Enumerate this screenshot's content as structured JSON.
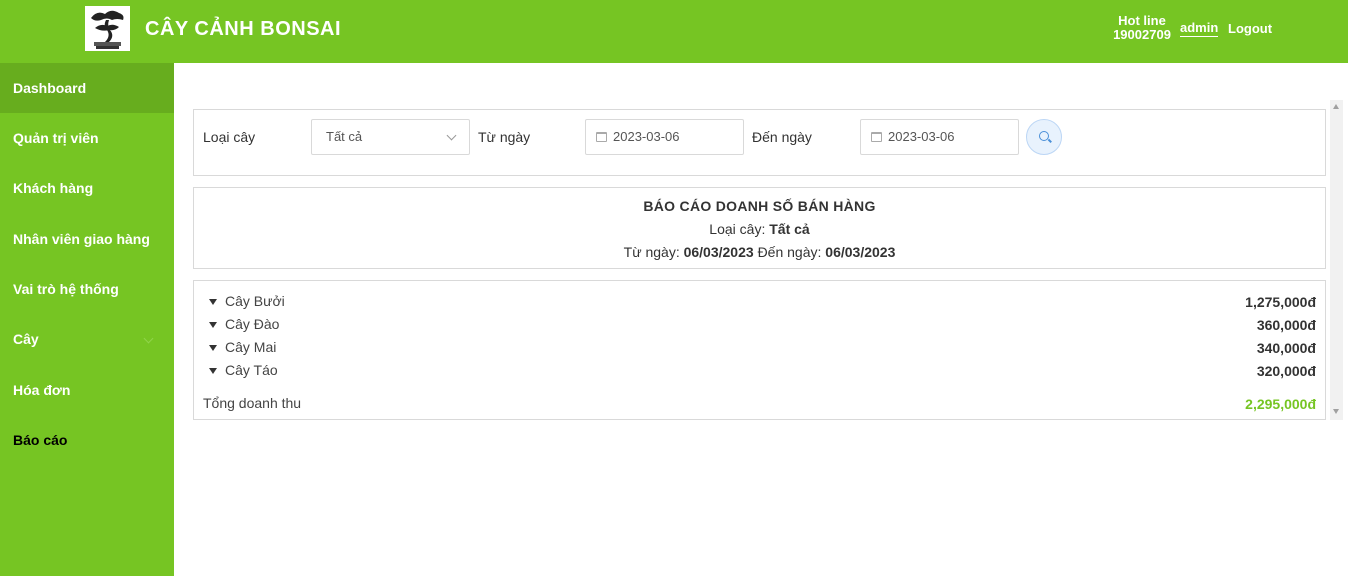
{
  "header": {
    "brand": "CÂY CẢNH BONSAI",
    "hotline_label": "Hot line",
    "hotline_number": "19002709",
    "admin_label": "admin",
    "logout_label": "Logout"
  },
  "sidebar": {
    "items": [
      {
        "label": "Dashboard"
      },
      {
        "label": "Quản trị viên"
      },
      {
        "label": "Khách hàng"
      },
      {
        "label": "Nhân viên giao hàng"
      },
      {
        "label": "Vai trò hệ thống"
      },
      {
        "label": "Cây"
      },
      {
        "label": "Hóa đơn"
      },
      {
        "label": "Báo cáo"
      }
    ]
  },
  "filter": {
    "type_label": "Loại cây",
    "type_value": "Tất cả",
    "from_label": "Từ ngày",
    "from_value": "2023-03-06",
    "to_label": "Đến ngày",
    "to_value": "2023-03-06"
  },
  "report": {
    "title": "BÁO CÁO DOANH SỐ BÁN HÀNG",
    "type_prefix": "Loại cây:",
    "type_value": "Tất cả",
    "from_prefix": "Từ ngày:",
    "from_value": "06/03/2023",
    "to_prefix": "Đến ngày:",
    "to_value": "06/03/2023"
  },
  "results": {
    "rows": [
      {
        "name": "Cây Bưởi",
        "amount": "1,275,000đ"
      },
      {
        "name": "Cây Đào",
        "amount": "360,000đ"
      },
      {
        "name": "Cây Mai",
        "amount": "340,000đ"
      },
      {
        "name": "Cây Táo",
        "amount": "320,000đ"
      }
    ],
    "total_label": "Tổng doanh thu",
    "total_value": "2,295,000đ"
  },
  "colors": {
    "brand_green": "#76c523",
    "active_green": "#67ad1e"
  }
}
